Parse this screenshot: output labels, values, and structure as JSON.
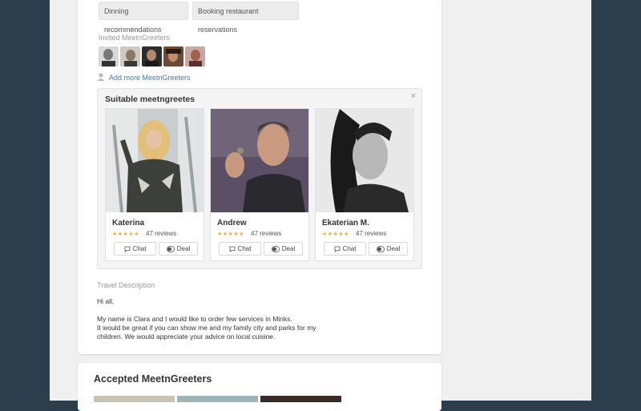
{
  "tags": [
    "Dinning recommendations",
    "Booking restaurant reservations"
  ],
  "invited": {
    "label": "Invited MeetnGreeters",
    "avatars": [
      "avatar-1",
      "avatar-2",
      "avatar-3",
      "avatar-4",
      "avatar-5"
    ]
  },
  "add_more": {
    "label": "Add more MeetnGreeters",
    "icon": "add-user-icon"
  },
  "suitable": {
    "title": "Suitable meetngreetes",
    "close_icon": "×",
    "people": [
      {
        "name": "Katerina",
        "rating": 5,
        "reviews": "47 reviews",
        "chat": "Chat",
        "deal": "Deal"
      },
      {
        "name": "Andrew",
        "rating": 5,
        "reviews": "47 reviews",
        "chat": "Chat",
        "deal": "Deal"
      },
      {
        "name": "Ekaterian M.",
        "rating": 5,
        "reviews": "47 reviews",
        "chat": "Chat",
        "deal": "Deal"
      }
    ]
  },
  "travel": {
    "label": "Travel Description",
    "greeting": "Hi all,",
    "line1": "My name is Clara and I would like to order few services in Minks.",
    "line2": "It would be great if you can show me and my family city and parks for my",
    "line3": "children. We would appreciate your advice on local cuisine."
  },
  "accepted": {
    "title": "Accepted MeetnGreeters"
  },
  "colors": {
    "background": "#2c3e4c",
    "link": "#3a7ab8",
    "star": "#f0b429"
  }
}
